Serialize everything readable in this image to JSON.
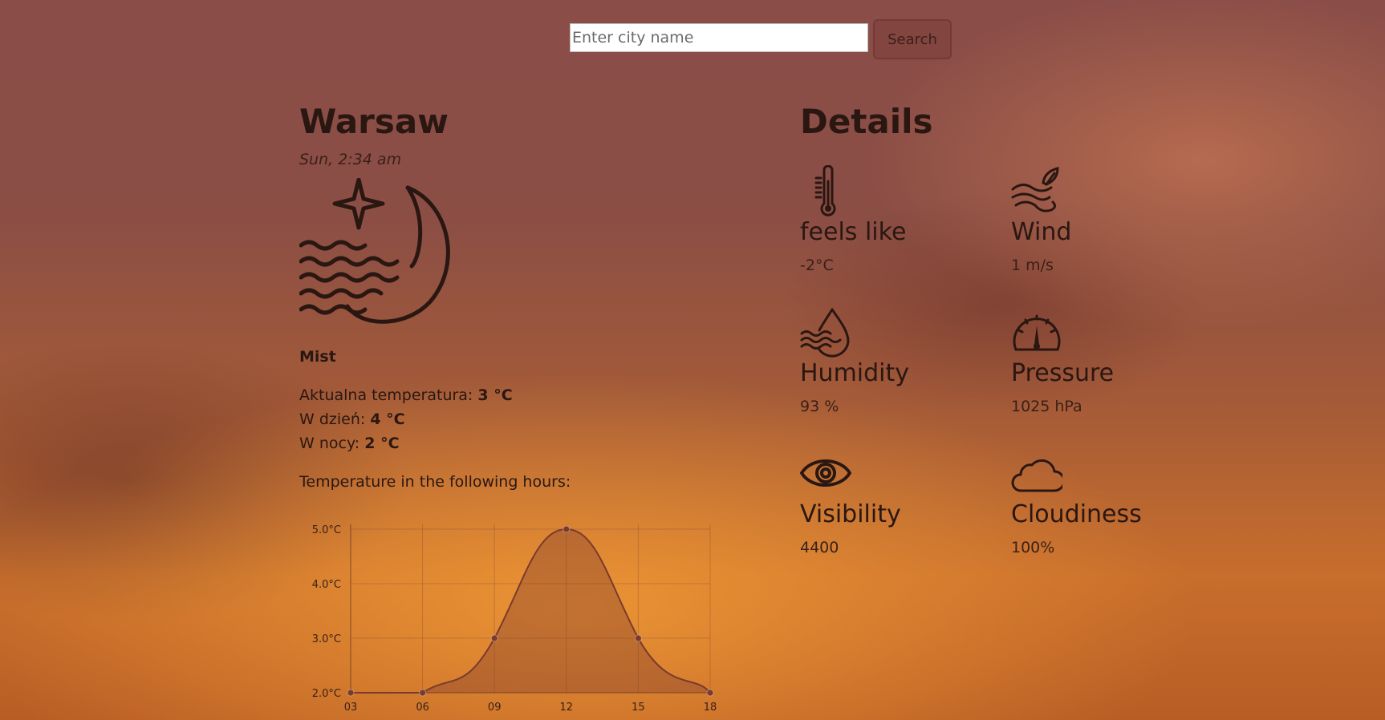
{
  "search": {
    "placeholder": "Enter city name",
    "button_label": "Search"
  },
  "current": {
    "city": "Warsaw",
    "datetime": "Sun, 2:34 am",
    "icon": "moon-star-mist-icon",
    "description": "Mist",
    "current_temp_label": "Aktualna temperatura:",
    "current_temp_value": "3 °C",
    "day_temp_label": "W dzień:",
    "day_temp_value": "4 °C",
    "night_temp_label": "W nocy:",
    "night_temp_value": "2 °C",
    "chart_title": "Temperature in the following hours:"
  },
  "details": {
    "title": "Details",
    "items": [
      {
        "label": "feels like",
        "value": "-2°C",
        "icon": "thermometer-icon"
      },
      {
        "label": "Wind",
        "value": "1 m/s",
        "icon": "wind-icon"
      },
      {
        "label": "Humidity",
        "value": "93 %",
        "icon": "humidity-drop-icon"
      },
      {
        "label": "Pressure",
        "value": "1025 hPa",
        "icon": "gauge-icon"
      },
      {
        "label": "Visibility",
        "value": "4400",
        "icon": "eye-icon"
      },
      {
        "label": "Cloudiness",
        "value": "100%",
        "icon": "cloud-icon"
      }
    ]
  },
  "chart_data": {
    "type": "area",
    "x": [
      "03",
      "06",
      "09",
      "12",
      "15",
      "18"
    ],
    "values": [
      2.0,
      2.0,
      3.0,
      5.0,
      3.0,
      2.0
    ],
    "y_ticks": [
      "5.0°C",
      "4.0°C",
      "3.0°C",
      "2.0°C"
    ],
    "ylim": [
      2,
      5
    ],
    "grid": true,
    "colors": {
      "line": "#7a3b2e",
      "fill": "rgba(120,55,45,0.35)",
      "grid": "rgba(90,50,40,0.25)"
    }
  }
}
